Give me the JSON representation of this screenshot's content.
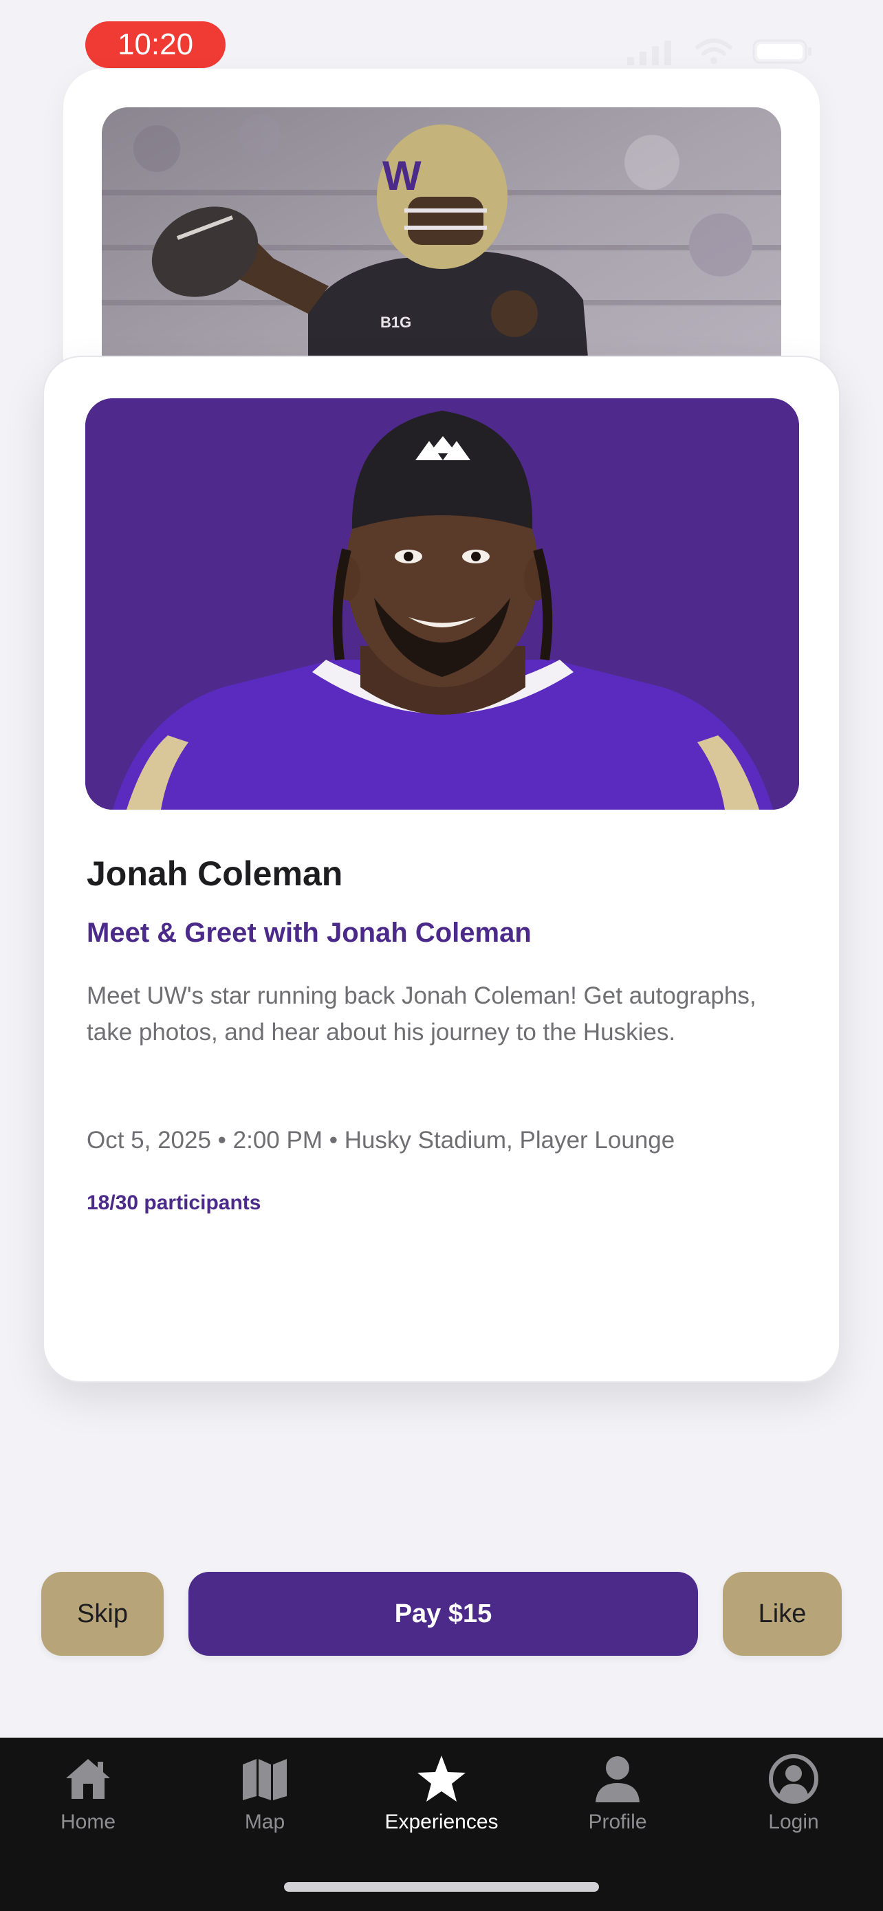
{
  "status_bar": {
    "time": "10:20"
  },
  "back_card": {
    "photo_subject": "quarterback-throwing"
  },
  "card": {
    "player_name": "Jonah Coleman",
    "event_title": "Meet & Greet with Jonah Coleman",
    "description": "Meet UW's star running back Jonah Coleman! Get autographs, take photos, and hear about his journey to the Huskies.",
    "meta": "Oct 5, 2025 • 2:00 PM • Husky Stadium, Player Lounge",
    "participants": "18/30 participants"
  },
  "actions": {
    "skip_label": "Skip",
    "pay_label": "Pay $15",
    "like_label": "Like"
  },
  "tab_bar": {
    "tabs": [
      {
        "label": "Home",
        "icon": "house-icon",
        "active": false
      },
      {
        "label": "Map",
        "icon": "map-icon",
        "active": false
      },
      {
        "label": "Experiences",
        "icon": "star-icon",
        "active": true
      },
      {
        "label": "Profile",
        "icon": "person-icon",
        "active": false
      },
      {
        "label": "Login",
        "icon": "account-circle-icon",
        "active": false
      }
    ]
  },
  "colors": {
    "brand_purple": "#4b2a8a",
    "brand_gold": "#b8a479",
    "status_red": "#ef3b34",
    "tab_bar_bg": "#121212"
  }
}
